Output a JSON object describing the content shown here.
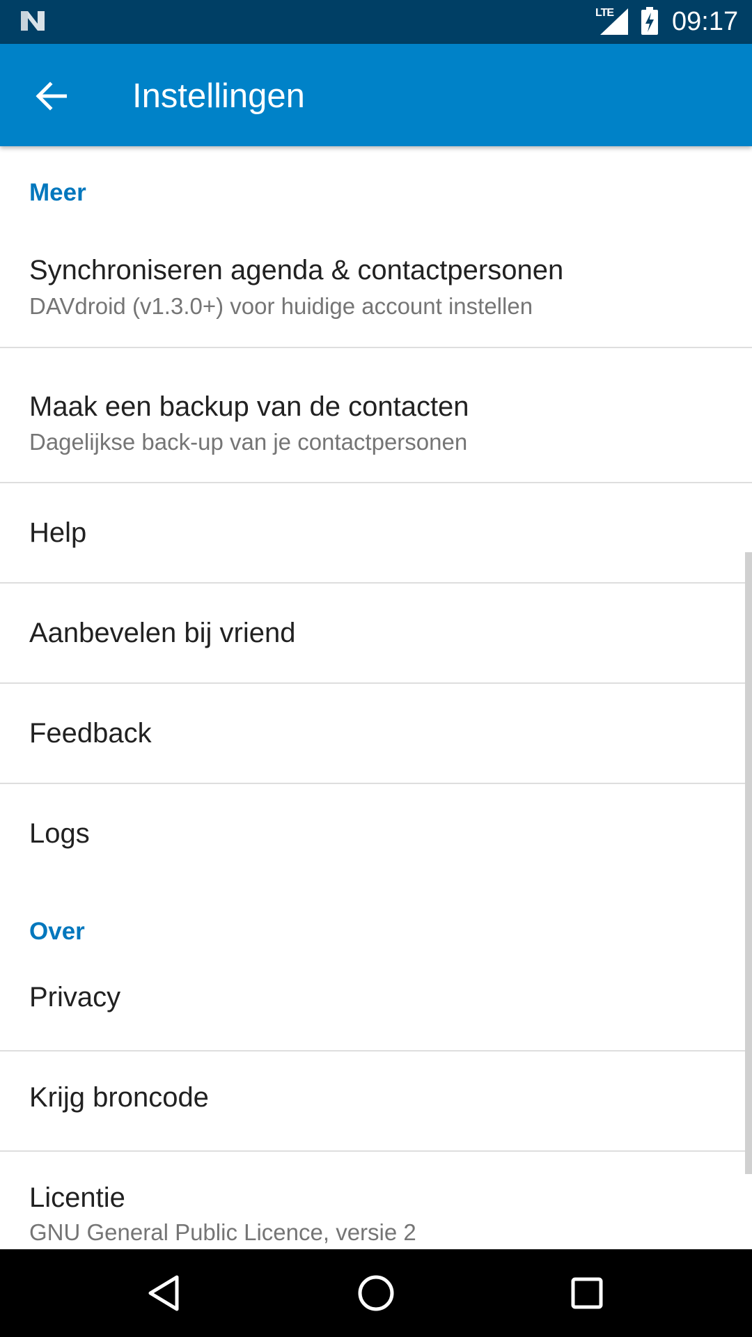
{
  "status_bar": {
    "network_label": "LTE",
    "time": "09:17",
    "icons": [
      "n-logo-icon",
      "signal-icon",
      "battery-charging-icon"
    ]
  },
  "app_bar": {
    "title": "Instellingen",
    "back_icon": "arrow-left-icon",
    "color": "#0082c8"
  },
  "sections": {
    "meer": {
      "header": "Meer",
      "items": [
        {
          "title": "Synchroniseren agenda & contactpersonen",
          "subtitle": "DAVdroid (v1.3.0+) voor huidige account instellen"
        },
        {
          "title": "Maak een backup van de contacten",
          "subtitle": "Dagelijkse back-up van je contactpersonen"
        },
        {
          "title": "Help"
        },
        {
          "title": "Aanbevelen bij vriend"
        },
        {
          "title": "Feedback"
        },
        {
          "title": "Logs"
        }
      ]
    },
    "over": {
      "header": "Over",
      "items": [
        {
          "title": "Privacy"
        },
        {
          "title": "Krijg broncode"
        },
        {
          "title": "Licentie",
          "subtitle": "GNU General Public Licence, versie 2"
        }
      ]
    }
  },
  "nav_bar": {
    "icons": [
      "back-triangle-icon",
      "home-circle-icon",
      "recents-square-icon"
    ]
  },
  "colors": {
    "status_bar": "#003f65",
    "accent": "#0277bd",
    "primary_text": "#212121",
    "secondary_text": "#757575"
  }
}
